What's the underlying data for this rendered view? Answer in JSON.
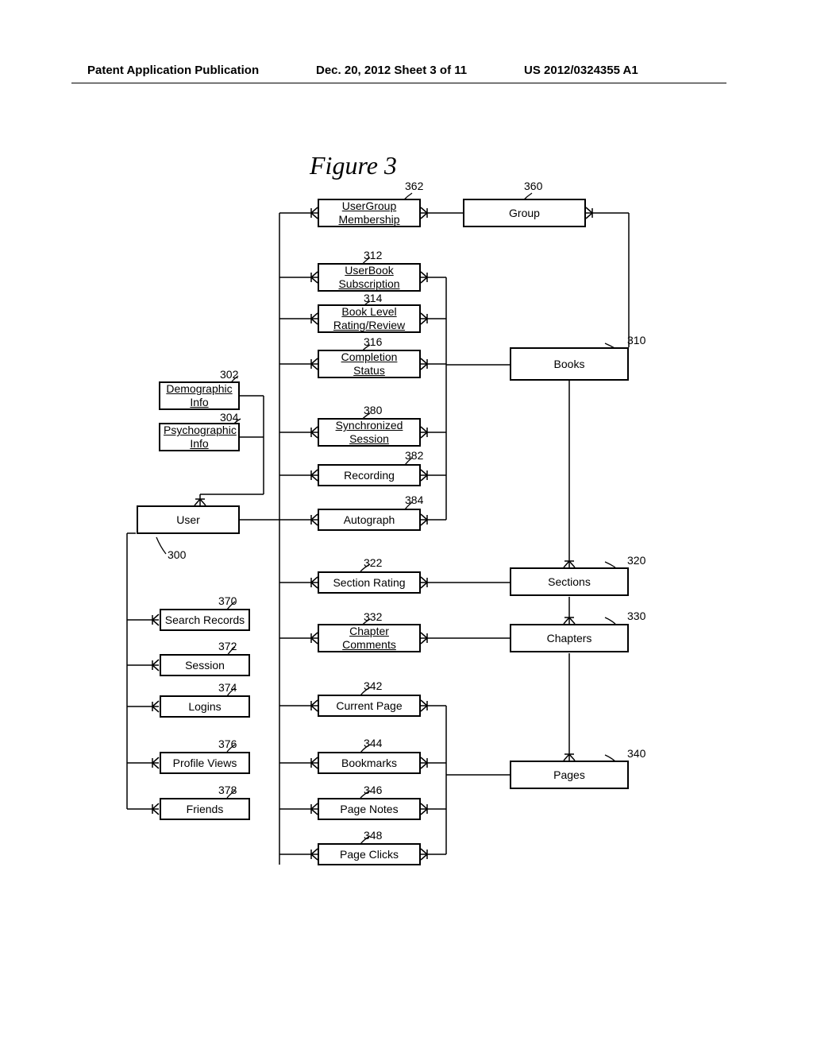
{
  "header": {
    "left": "Patent Application Publication",
    "mid": "Dec. 20, 2012  Sheet 3 of 11",
    "right": "US 2012/0324355 A1"
  },
  "figure_title": "Figure 3",
  "labels": {
    "n300": "300",
    "n302": "302",
    "n304": "304",
    "n310": "310",
    "n312": "312",
    "n314": "314",
    "n316": "316",
    "n320": "320",
    "n322": "322",
    "n330": "330",
    "n332": "332",
    "n340": "340",
    "n342": "342",
    "n344": "344",
    "n346": "346",
    "n348": "348",
    "n360": "360",
    "n362": "362",
    "n370": "370",
    "n372": "372",
    "n374": "374",
    "n376": "376",
    "n378": "378",
    "n380": "380",
    "n382": "382",
    "n384": "384"
  },
  "boxes": {
    "user": "User",
    "demo_info_a": "Demographic",
    "demo_info_b": "Info",
    "psych_info_a": "Psychographic",
    "psych_info_b": "Info",
    "search_records": "Search Records",
    "session": "Session",
    "logins": "Logins",
    "profile_views": "Profile Views",
    "friends": "Friends",
    "ugm_a": "UserGroup",
    "ugm_b": "Membership",
    "group": "Group",
    "ubs_a": "UserBook",
    "ubs_b": "Subscription",
    "blr_a": "Book Level",
    "blr_b": "Rating/Review",
    "comp_a": "Completion",
    "comp_b": "Status",
    "sync_a": "Synchronized",
    "sync_b": "Session",
    "recording": "Recording",
    "autograph": "Autograph",
    "section_rating": "Section Rating",
    "chapter_c_a": "Chapter",
    "chapter_c_b": "Comments",
    "current_page": "Current Page",
    "bookmarks": "Bookmarks",
    "page_notes": "Page Notes",
    "page_clicks": "Page Clicks",
    "books": "Books",
    "sections": "Sections",
    "chapters": "Chapters",
    "pages": "Pages"
  }
}
